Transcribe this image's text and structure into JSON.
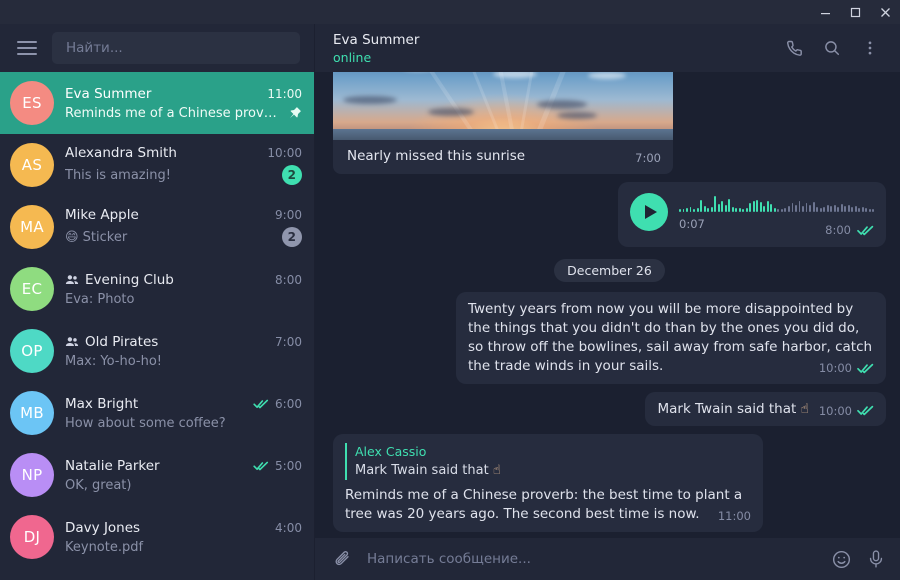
{
  "window": {
    "minimize_label": "minimize",
    "maximize_label": "maximize",
    "close_label": "close"
  },
  "sidebar": {
    "menu_icon": "hamburger-menu-icon",
    "search": {
      "placeholder": "Найти...",
      "value": ""
    },
    "chats": [
      {
        "initials": "ES",
        "avatar_color": "#f48b82",
        "name": "Eva Summer",
        "time": "11:00",
        "message": "Reminds me of a Chinese prover...",
        "active": true,
        "pinned": true,
        "group": false,
        "badge": null,
        "badge_type": null,
        "ticks": false,
        "emoji": ""
      },
      {
        "initials": "AS",
        "avatar_color": "#f5b951",
        "name": "Alexandra Smith",
        "time": "10:00",
        "message": "This is amazing!",
        "active": false,
        "pinned": false,
        "group": false,
        "badge": "2",
        "badge_type": "unread",
        "ticks": false,
        "emoji": ""
      },
      {
        "initials": "MA",
        "avatar_color": "#f5b951",
        "name": "Mike Apple",
        "time": "9:00",
        "message": "Sticker",
        "active": false,
        "pinned": false,
        "group": false,
        "badge": "2",
        "badge_type": "muted",
        "ticks": false,
        "emoji": "😄"
      },
      {
        "initials": "EC",
        "avatar_color": "#8fdc80",
        "name": "Evening Club",
        "time": "8:00",
        "message": "Eva: Photo",
        "active": false,
        "pinned": false,
        "group": true,
        "badge": null,
        "badge_type": null,
        "ticks": false,
        "emoji": ""
      },
      {
        "initials": "OP",
        "avatar_color": "#4ed9c5",
        "name": "Old Pirates",
        "time": "7:00",
        "message": "Max: Yo-ho-ho!",
        "active": false,
        "pinned": false,
        "group": true,
        "badge": null,
        "badge_type": null,
        "ticks": false,
        "emoji": ""
      },
      {
        "initials": "MB",
        "avatar_color": "#6cc5f5",
        "name": "Max Bright",
        "time": "6:00",
        "message": "How about some coffee?",
        "active": false,
        "pinned": false,
        "group": false,
        "badge": null,
        "badge_type": null,
        "ticks": true,
        "emoji": ""
      },
      {
        "initials": "NP",
        "avatar_color": "#b98ef5",
        "name": "Natalie Parker",
        "time": "5:00",
        "message": "OK, great)",
        "active": false,
        "pinned": false,
        "group": false,
        "badge": null,
        "badge_type": null,
        "ticks": true,
        "emoji": ""
      },
      {
        "initials": "DJ",
        "avatar_color": "#f0678f",
        "name": "Davy Jones",
        "time": "4:00",
        "message": "Keynote.pdf",
        "active": false,
        "pinned": false,
        "group": false,
        "badge": null,
        "badge_type": null,
        "ticks": false,
        "emoji": ""
      }
    ]
  },
  "chat_header": {
    "name": "Eva Summer",
    "status": "online",
    "status_color": "#3fdfb0",
    "actions": [
      "phone-icon",
      "search-icon",
      "more-vertical-icon"
    ]
  },
  "messages": {
    "photo": {
      "caption": "Nearly missed this sunrise",
      "time": "7:00",
      "direction": "in"
    },
    "voice": {
      "duration": "0:07",
      "time": "8:00",
      "direction": "out",
      "read": true,
      "play_icon": "play-icon"
    },
    "date_divider": "December 26",
    "quote_long": {
      "text": "Twenty years from now you will be more disappointed by the things that you didn't do than by the ones you did do, so throw off the bowlines, sail away from safe harbor, catch the trade winds in your sails.",
      "time": "10:00",
      "direction": "out",
      "read": true
    },
    "attribution": {
      "text": "Mark Twain said that",
      "emoji": "☝",
      "time": "10:00",
      "direction": "out",
      "read": true
    },
    "reply": {
      "quote_author": "Alex Cassio",
      "quote_text": "Mark Twain said that",
      "quote_emoji": "☝",
      "text": "Reminds me of a Chinese proverb: the best time to plant a tree was 20 years ago. The second best time is now.",
      "time": "11:00",
      "direction": "in"
    }
  },
  "composer": {
    "attach_icon": "paperclip-icon",
    "placeholder": "Написать сообщение...",
    "value": "",
    "emoji_icon": "smiley-icon",
    "mic_icon": "microphone-icon"
  },
  "colors": {
    "accent": "#3fdfb0",
    "active_chat": "#2aa189",
    "sidebar_bg": "#222738",
    "chat_bg": "#1b2030",
    "bubble_bg": "#262c3e"
  }
}
